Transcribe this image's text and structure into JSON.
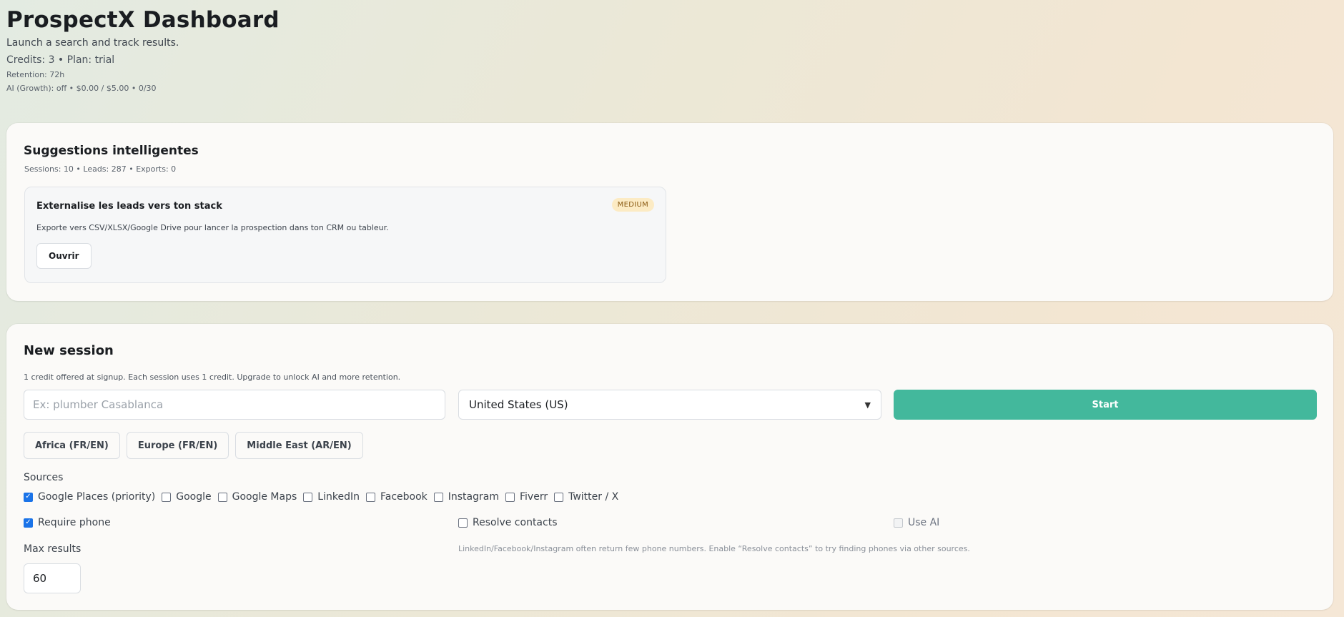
{
  "header": {
    "title": "ProspectX Dashboard",
    "subtitle": "Launch a search and track results.",
    "credits": "Credits: 3 • Plan: trial",
    "retention": "Retention: 72h",
    "ai": "AI (Growth): off • $0.00 / $5.00 • 0/30"
  },
  "suggestions": {
    "title": "Suggestions intelligentes",
    "stats": "Sessions: 10 • Leads: 287 • Exports: 0",
    "item": {
      "title": "Externalise les leads vers ton stack",
      "badge": "MEDIUM",
      "description": "Exporte vers CSV/XLSX/Google Drive pour lancer la prospection dans ton CRM ou tableur.",
      "button": "Ouvrir"
    }
  },
  "session": {
    "title": "New session",
    "note": "1 credit offered at signup. Each session uses 1 credit. Upgrade to unlock AI and more retention.",
    "search_placeholder": "Ex: plumber Casablanca",
    "country": "United States (US)",
    "start": "Start",
    "presets": [
      "Africa (FR/EN)",
      "Europe (FR/EN)",
      "Middle East (AR/EN)"
    ],
    "sources_label": "Sources",
    "sources": [
      {
        "label": "Google Places (priority)",
        "checked": true
      },
      {
        "label": "Google",
        "checked": false
      },
      {
        "label": "Google Maps",
        "checked": false
      },
      {
        "label": "LinkedIn",
        "checked": false
      },
      {
        "label": "Facebook",
        "checked": false
      },
      {
        "label": "Instagram",
        "checked": false
      },
      {
        "label": "Fiverr",
        "checked": false
      },
      {
        "label": "Twitter / X",
        "checked": false
      }
    ],
    "require_phone": "Require phone",
    "resolve_contacts": "Resolve contacts",
    "use_ai": "Use AI",
    "max_label": "Max results",
    "max_value": "60",
    "hint": "LinkedIn/Facebook/Instagram often return few phone numbers. Enable “Resolve contacts” to try finding phones via other sources."
  },
  "colors": {
    "accent": "#43b89c",
    "badge_bg": "#fcebc4",
    "checkbox": "#1a73e8"
  }
}
